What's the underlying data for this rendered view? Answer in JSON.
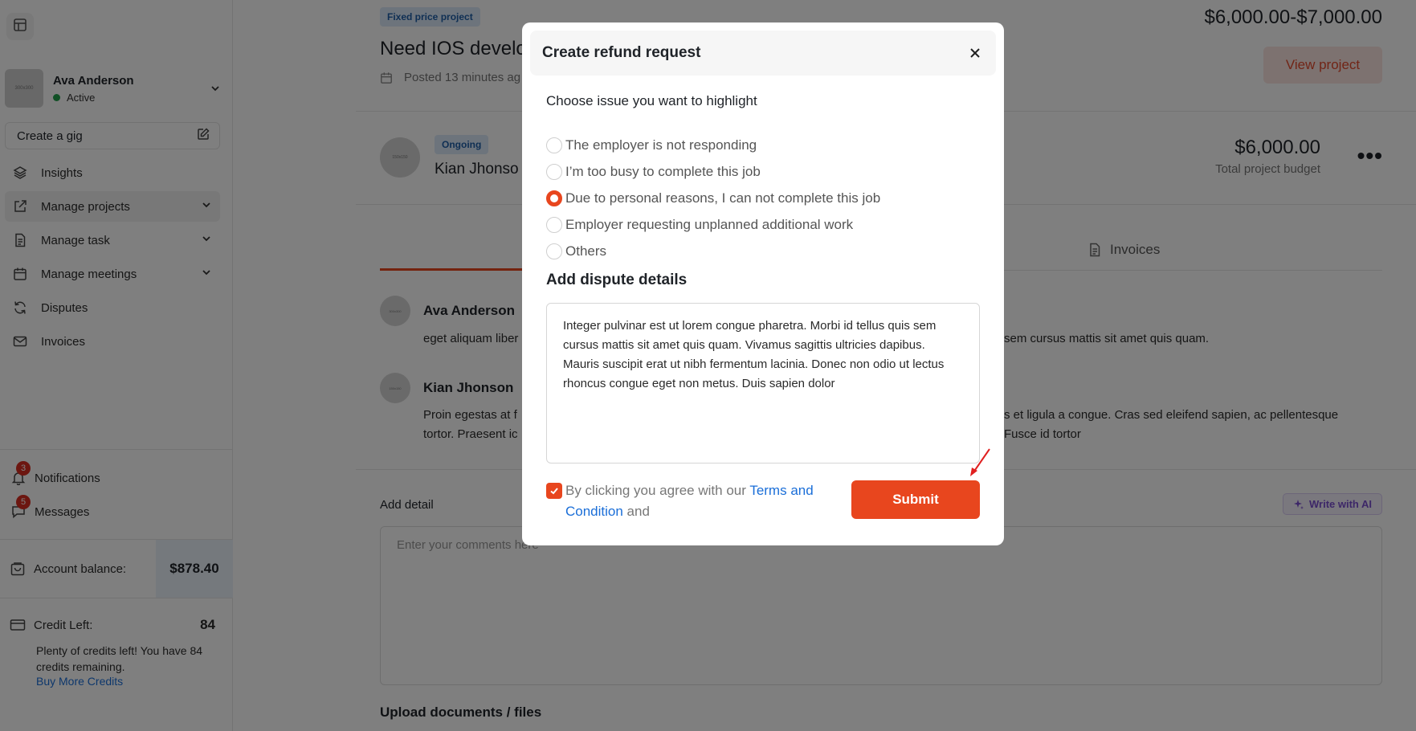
{
  "sidebar": {
    "user": {
      "avatar_text": "300x300",
      "name": "Ava Anderson",
      "status": "Active"
    },
    "create_gig_label": "Create a gig",
    "items": [
      {
        "label": "Insights",
        "icon": "layers-icon"
      },
      {
        "label": "Manage projects",
        "icon": "external-link-icon",
        "active": true
      },
      {
        "label": "Manage task",
        "icon": "document-icon"
      },
      {
        "label": "Manage meetings",
        "icon": "calendar-icon"
      },
      {
        "label": "Disputes",
        "icon": "refresh-icon"
      },
      {
        "label": "Invoices",
        "icon": "mail-icon"
      }
    ],
    "notifications": {
      "label": "Notifications",
      "count": "3"
    },
    "messages": {
      "label": "Messages",
      "count": "5"
    },
    "balance": {
      "label": "Account balance:",
      "value": "$878.40"
    },
    "credit": {
      "label": "Credit Left:",
      "value": "84",
      "note": "Plenty of credits left! You have 84 credits remaining.",
      "link": "Buy More Credits"
    }
  },
  "project": {
    "tag": "Fixed price project",
    "title": "Need IOS develo",
    "posted": "Posted 13 minutes ag",
    "price_range": "$6,000.00-$7,000.00",
    "view_button": "View project"
  },
  "contract": {
    "avatar_text": "150x150",
    "status": "Ongoing",
    "name": "Kian Jhonso",
    "budget": "$6,000.00",
    "budget_label": "Total project budget",
    "more": "•••"
  },
  "tabs": {
    "invoices_label": "Invoices"
  },
  "comments": [
    {
      "avatar_text": "300x300",
      "name": "Ava Anderson",
      "text_left": "eget aliquam liber",
      "text_right": "sem cursus mattis sit amet quis quam."
    },
    {
      "avatar_text": "150x150",
      "name": "Kian Jhonson",
      "text_left_1": "Proin egestas at f",
      "text_right_1": "s et ligula a congue. Cras sed eleifend sapien, ac pellentesque",
      "text_left_2": "tortor. Praesent ic",
      "text_right_2": "Fusce id tortor"
    }
  ],
  "add_detail": {
    "label": "Add detail",
    "ai_button": "Write with AI",
    "placeholder": "Enter your comments here"
  },
  "upload_title": "Upload documents / files",
  "modal": {
    "title": "Create refund request",
    "question": "Choose issue you want to highlight",
    "options": [
      {
        "label": "The employer is not responding",
        "checked": false
      },
      {
        "label": "I’m too busy to complete this job",
        "checked": false
      },
      {
        "label": "Due to personal reasons, I can not complete this job",
        "checked": true
      },
      {
        "label": "Employer requesting unplanned additional work",
        "checked": false
      },
      {
        "label": "Others",
        "checked": false
      }
    ],
    "details_title": "Add dispute details",
    "details_text": "Integer pulvinar est ut lorem congue pharetra. Morbi id tellus quis sem cursus mattis sit amet quis quam. Vivamus sagittis ultricies dapibus. Mauris suscipit erat ut nibh fermentum lacinia. Donec non odio ut lectus rhoncus congue eget non metus. Duis sapien dolor",
    "agree_prefix": "By clicking you agree with our ",
    "agree_link": "Terms and Condition",
    "agree_suffix": " and",
    "submit": "Submit"
  },
  "colors": {
    "accent": "#e8461e",
    "link": "#1a6ed8",
    "overlay": "rgba(0,0,0,0.5)"
  }
}
